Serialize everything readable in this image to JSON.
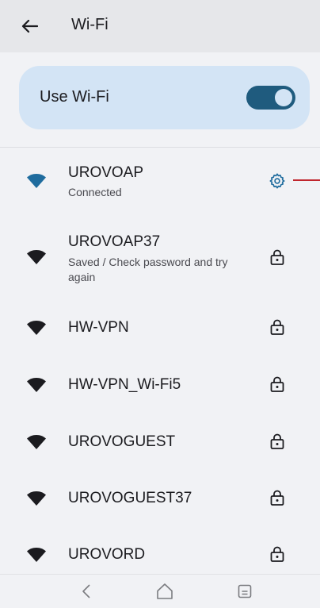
{
  "header": {
    "title": "Wi-Fi"
  },
  "use_wifi": {
    "label": "Use Wi-Fi",
    "enabled": true
  },
  "networks": [
    {
      "name": "UROVOAP",
      "status": "Connected",
      "icon": "gear-icon",
      "signal": "full",
      "connected": true
    },
    {
      "name": "UROVOAP37",
      "status": "Saved / Check password and try again",
      "icon": "lock-icon",
      "signal": "full"
    },
    {
      "name": "HW-VPN",
      "status": "",
      "icon": "lock-icon",
      "signal": "full"
    },
    {
      "name": "HW-VPN_Wi-Fi5",
      "status": "",
      "icon": "lock-icon",
      "signal": "full"
    },
    {
      "name": "UROVOGUEST",
      "status": "",
      "icon": "lock-icon",
      "signal": "full"
    },
    {
      "name": "UROVOGUEST37",
      "status": "",
      "icon": "lock-icon",
      "signal": "full"
    },
    {
      "name": "UROVORD",
      "status": "",
      "icon": "lock-icon",
      "signal": "full"
    }
  ],
  "colors": {
    "accent": "#1f5b7e",
    "card": "#d3e4f5",
    "connected_icon": "#1f6c9e",
    "annotation": "#c0262d"
  }
}
